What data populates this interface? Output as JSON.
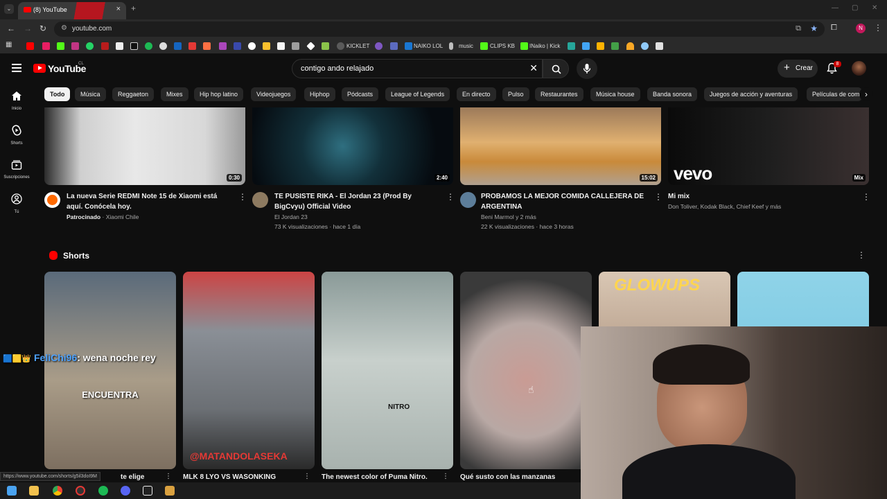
{
  "browser": {
    "tab_title": "(8) YouTube",
    "url": "youtube.com",
    "bookmarks": [
      "KICKLET",
      "NAIKO LOL",
      "music",
      "CLIPS KB",
      "INaiko | Kick"
    ],
    "profile_initial": "N"
  },
  "youtube": {
    "logo_text": "YouTube",
    "country": "CL",
    "search_query": "contigo ando relajado",
    "create_label": "Crear",
    "notif_count": "8"
  },
  "sidebar": [
    {
      "label": "Inicio",
      "icon": "home-icon"
    },
    {
      "label": "Shorts",
      "icon": "shorts-icon"
    },
    {
      "label": "Suscripciones",
      "icon": "subscriptions-icon"
    },
    {
      "label": "Tú",
      "icon": "you-icon"
    }
  ],
  "chips": [
    "Todo",
    "Música",
    "Reggaeton",
    "Mixes",
    "Hip hop latino",
    "Videojuegos",
    "Hiphop",
    "Pódcasts",
    "League of Legends",
    "En directo",
    "Pulso",
    "Restaurantes",
    "Música house",
    "Banda sonora",
    "Juegos de acción y aventuras",
    "Películas de com"
  ],
  "videos": [
    {
      "title": "La nueva Serie REDMI Note 15 de Xiaomi está aquí. Conócela hoy.",
      "channel_prefix": "Patrocinado",
      "channel": "Xiaomi Chile",
      "stats": "",
      "duration": "0:30"
    },
    {
      "title": "TE PUSISTE RIKA - El Jordan 23 (Prod By BigCvyu) Official Video",
      "channel": "El Jordan 23",
      "stats": "73 K visualizaciones · hace 1 día",
      "duration": "2:40"
    },
    {
      "title": "PROBAMOS LA MEJOR COMIDA CALLEJERA DE ARGENTINA",
      "channel": "Beni Marmol y 2 más",
      "stats": "22 K visualizaciones · hace 3 horas",
      "duration": "15:02"
    },
    {
      "title": "Mi mix",
      "channel": "Don Toliver, Kodak Black, Chief Keef y más",
      "stats": "",
      "duration": "Mix",
      "thumb_text": "vevo"
    }
  ],
  "shorts": {
    "heading": "Shorts",
    "items": [
      {
        "title": "te elige",
        "overlay": "ENCUENTRA"
      },
      {
        "title": "MLK 8 LYO VS WASONKING",
        "overlay": "@MATANDOLASEKA"
      },
      {
        "title": "The newest color of Puma Nitro.",
        "overlay": "NITRO"
      },
      {
        "title": "Qué susto con las manzanas",
        "overlay": ""
      },
      {
        "title": "",
        "overlay": "GLOWUPS"
      },
      {
        "title": "",
        "overlay": ""
      }
    ]
  },
  "overlay": {
    "chat_user": "FeliChi96",
    "chat_message": ": wena noche rey",
    "status_url": "https://www.youtube.com/shorts/g5il3doI9M"
  },
  "colors": {
    "brand_red": "#ff0000",
    "background": "#0f0f0f",
    "chip_bg": "#272727"
  }
}
